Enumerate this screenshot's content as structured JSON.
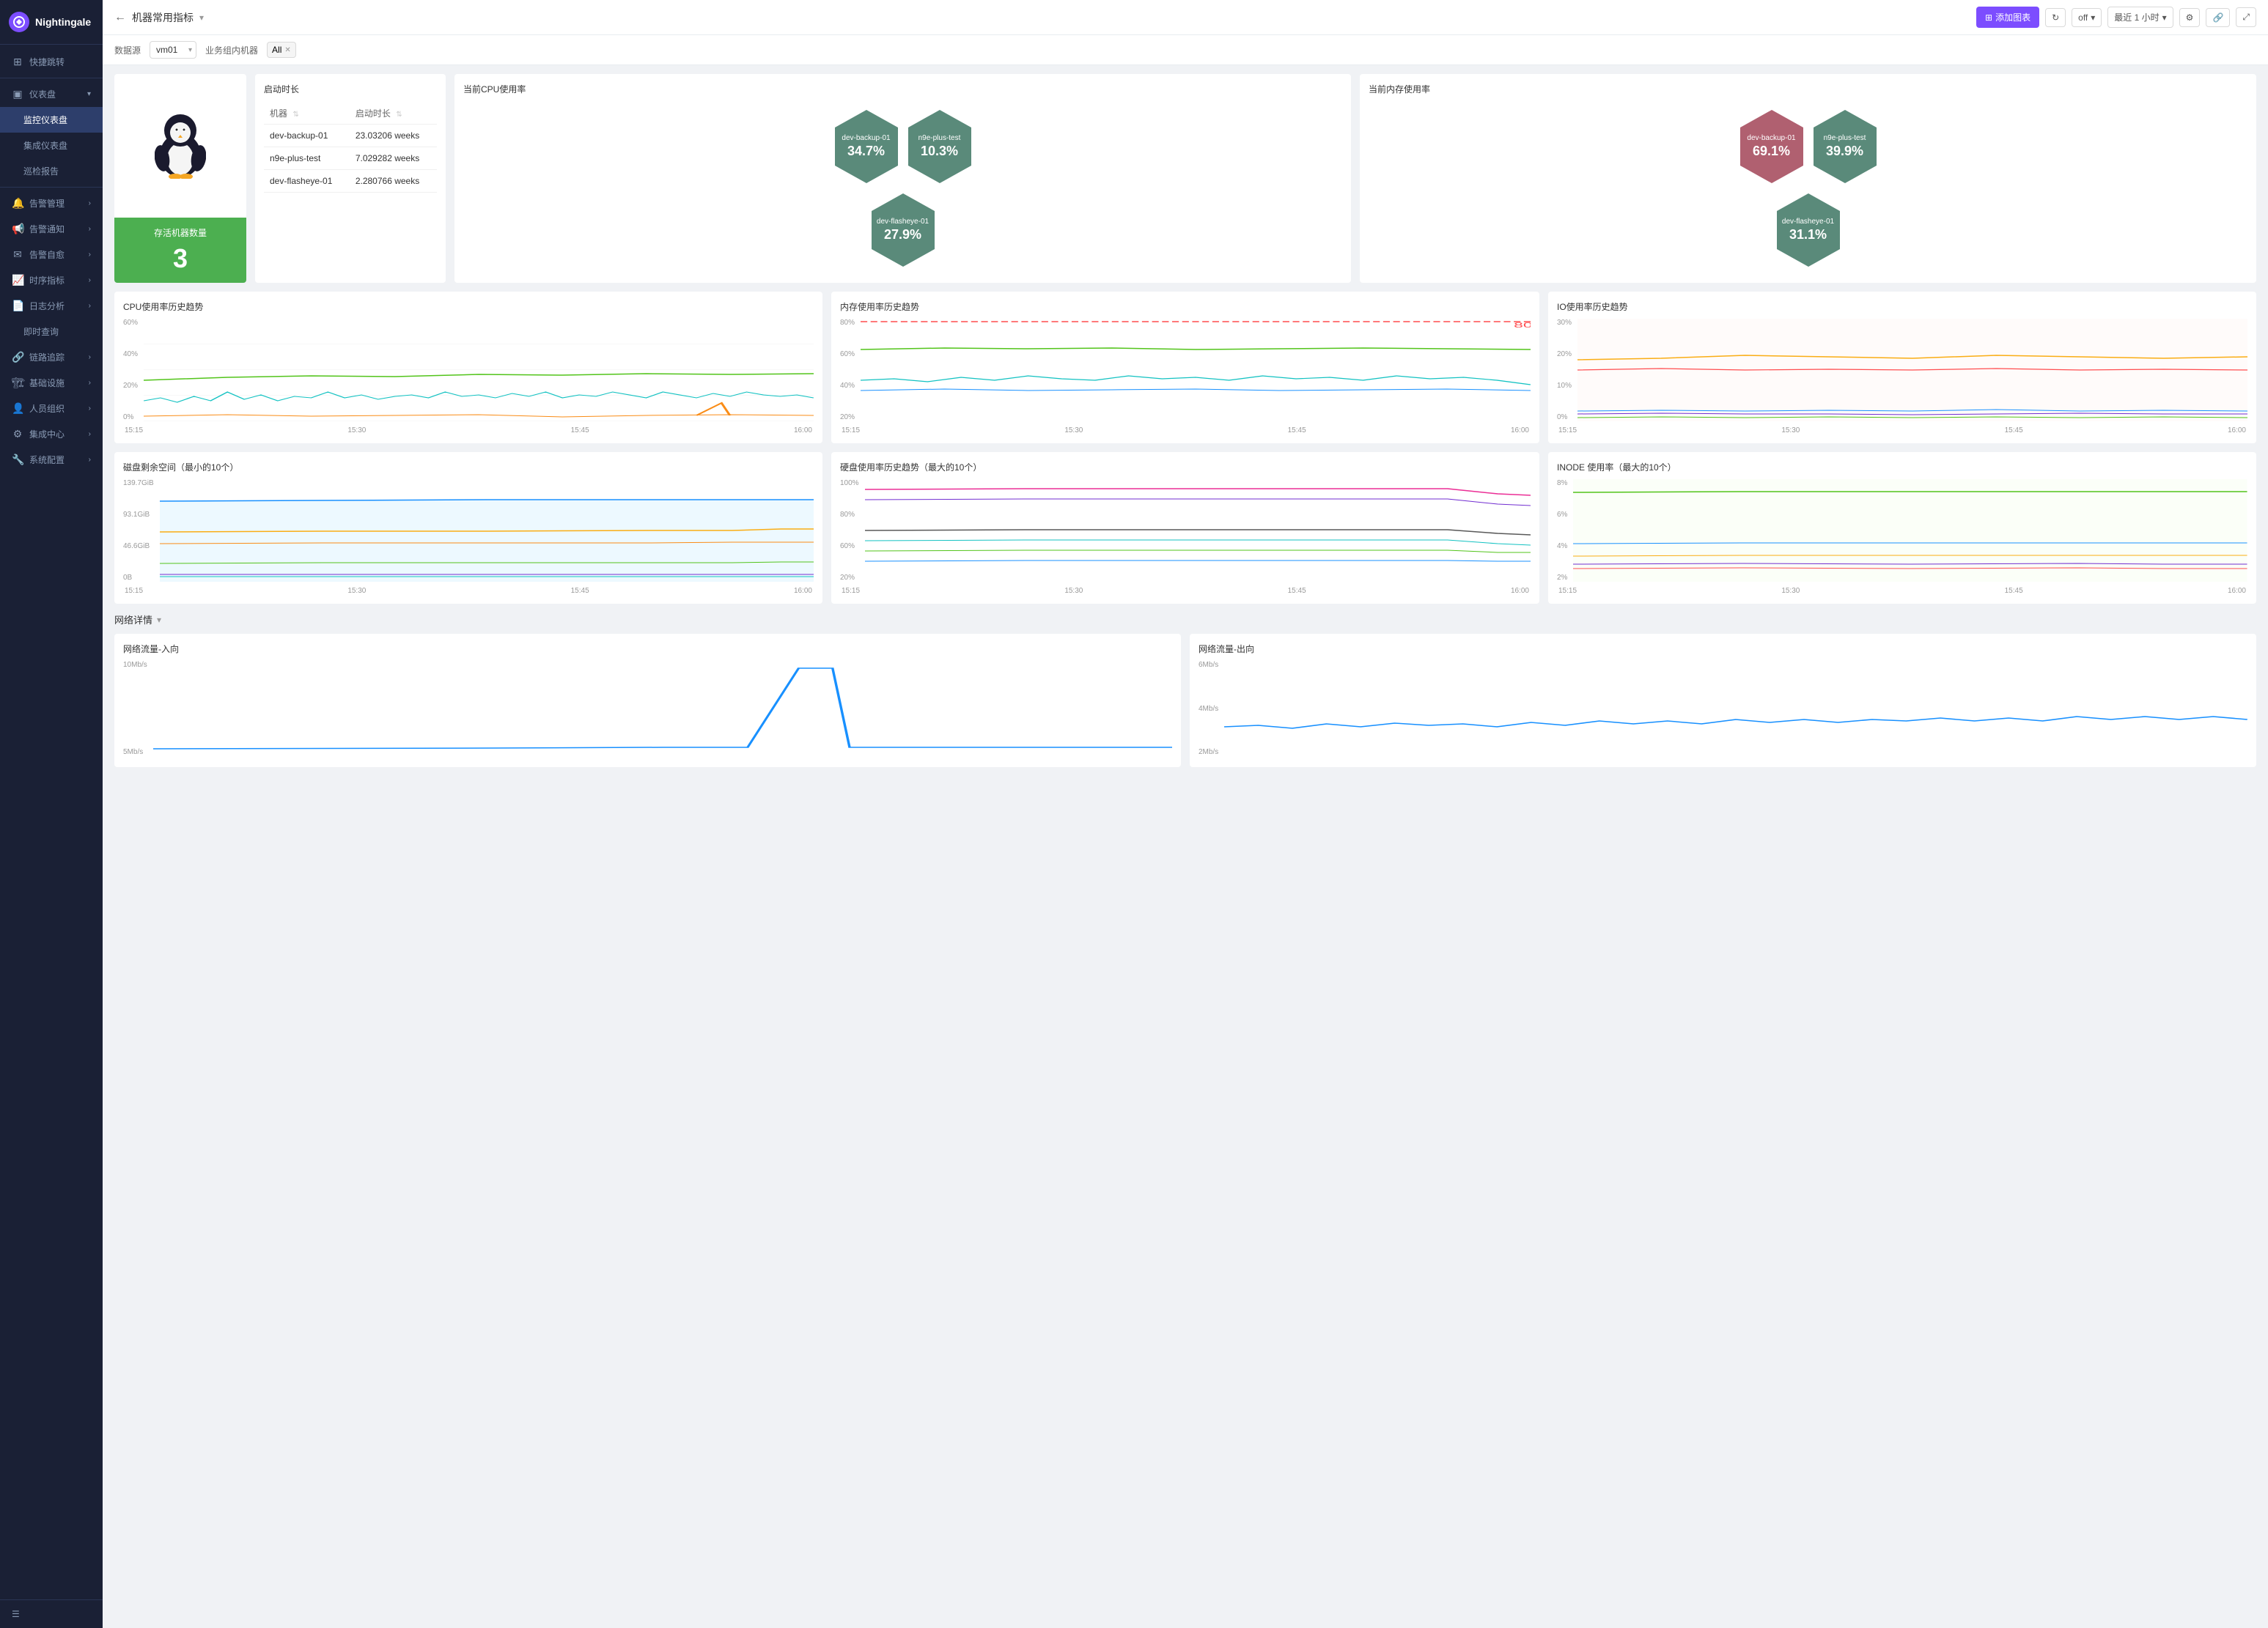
{
  "sidebar": {
    "logo_text": "Nightingale",
    "items": [
      {
        "id": "quick-jump",
        "label": "快捷跳转",
        "icon": "⊞",
        "has_arrow": false
      },
      {
        "id": "dashboard",
        "label": "仪表盘",
        "icon": "📊",
        "has_arrow": true
      },
      {
        "id": "monitor-dashboard",
        "label": "监控仪表盘",
        "icon": "",
        "has_arrow": false,
        "active": true,
        "sub": true
      },
      {
        "id": "integrated-dashboard",
        "label": "集成仪表盘",
        "icon": "",
        "has_arrow": false,
        "sub": true
      },
      {
        "id": "patrol-report",
        "label": "巡检报告",
        "icon": "",
        "has_arrow": false,
        "sub": true
      },
      {
        "id": "alert-management",
        "label": "告警管理",
        "icon": "🔔",
        "has_arrow": true
      },
      {
        "id": "alert-notify",
        "label": "告警通知",
        "icon": "📢",
        "has_arrow": true
      },
      {
        "id": "alert-self-heal",
        "label": "告警自愈",
        "icon": "✉",
        "has_arrow": true
      },
      {
        "id": "time-metrics",
        "label": "时序指标",
        "icon": "📈",
        "has_arrow": true
      },
      {
        "id": "log-analysis",
        "label": "日志分析",
        "icon": "📄",
        "has_arrow": true
      },
      {
        "id": "instant-query",
        "label": "即时查询",
        "icon": "",
        "has_arrow": false,
        "sub": true
      },
      {
        "id": "trace",
        "label": "链路追踪",
        "icon": "🔗",
        "has_arrow": true
      },
      {
        "id": "infrastructure",
        "label": "基础设施",
        "icon": "🏗",
        "has_arrow": true
      },
      {
        "id": "people-org",
        "label": "人员组织",
        "icon": "👤",
        "has_arrow": true
      },
      {
        "id": "integration",
        "label": "集成中心",
        "icon": "⚙",
        "has_arrow": true
      },
      {
        "id": "sys-config",
        "label": "系统配置",
        "icon": "🔧",
        "has_arrow": true
      }
    ],
    "bottom_icon": "☰"
  },
  "topbar": {
    "back_icon": "←",
    "title": "机器常用指标",
    "arrow": "▾",
    "add_chart_label": "添加图表",
    "refresh_icon": "↻",
    "auto_refresh_label": "off",
    "time_range_label": "最近 1 小时",
    "settings_icon": "⚙",
    "share_icon": "🔗",
    "fullscreen_icon": "⤢"
  },
  "filterbar": {
    "source_label": "数据源",
    "source_value": "vm01",
    "group_label": "业务组内机器",
    "group_tag": "All"
  },
  "top_panel": {
    "penguin_alt": "Linux Penguin",
    "live_machines_label": "存活机器数量",
    "live_machines_count": "3",
    "uptime_title": "启动时长",
    "uptime_col1": "机器",
    "uptime_col2": "启动时长",
    "uptime_rows": [
      {
        "machine": "dev-backup-01",
        "uptime": "23.03206 weeks"
      },
      {
        "machine": "n9e-plus-test",
        "uptime": "7.029282 weeks"
      },
      {
        "machine": "dev-flasheye-01",
        "uptime": "2.280766 weeks"
      }
    ],
    "cpu_title": "当前CPU使用率",
    "cpu_hexes": [
      {
        "name": "dev-backup-01",
        "value": "34.7%",
        "color": "#5a8a7a"
      },
      {
        "name": "n9e-plus-test",
        "value": "10.3%",
        "color": "#5a8a7a"
      },
      {
        "name": "dev-flasheye-01",
        "value": "27.9%",
        "color": "#5a8a7a"
      }
    ],
    "mem_title": "当前内存使用率",
    "mem_hexes": [
      {
        "name": "dev-backup-01",
        "value": "69.1%",
        "color": "#b06070"
      },
      {
        "name": "n9e-plus-test",
        "value": "39.9%",
        "color": "#5a8a7a"
      },
      {
        "name": "dev-flasheye-01",
        "value": "31.1%",
        "color": "#5a8a7a"
      }
    ]
  },
  "charts_row1": [
    {
      "title": "CPU使用率历史趋势",
      "y_max": "60%",
      "y_mid": "40%",
      "y_low": "20%",
      "y_min": "0%",
      "times": [
        "15:15",
        "15:30",
        "15:45",
        "16:00"
      ]
    },
    {
      "title": "内存使用率历史趋势",
      "y_max": "80%",
      "y_mid": "60%",
      "y_low": "40%",
      "y_min": "20%",
      "times": [
        "15:15",
        "15:30",
        "15:45",
        "16:00"
      ],
      "threshold": "80"
    },
    {
      "title": "IO使用率历史趋势",
      "y_max": "30%",
      "y_mid": "20%",
      "y_low": "10%",
      "y_min": "0%",
      "times": [
        "15:15",
        "15:30",
        "15:45",
        "16:00"
      ]
    }
  ],
  "charts_row2": [
    {
      "title": "磁盘剩余空间（最小的10个）",
      "y_max": "139.7GiB",
      "y_mid": "93.1GiB",
      "y_low": "46.6GiB",
      "y_min": "0B",
      "times": [
        "15:15",
        "15:30",
        "15:45",
        "16:00"
      ]
    },
    {
      "title": "硬盘使用率历史趋势（最大的10个）",
      "y_max": "100%",
      "y_mid": "80%",
      "y_low": "60%",
      "y_min": "20%",
      "times": [
        "15:15",
        "15:30",
        "15:45",
        "16:00"
      ]
    },
    {
      "title": "INODE 使用率（最大的10个）",
      "y_max": "8%",
      "y_mid": "6%",
      "y_low": "4%",
      "y_min": "2%",
      "times": [
        "15:15",
        "15:30",
        "15:45",
        "16:00"
      ]
    }
  ],
  "network_section": {
    "title": "网络详情",
    "arrow": "▾",
    "inbound_title": "网络流量-入向",
    "inbound_y_max": "10Mb/s",
    "inbound_y_mid": "5Mb/s",
    "outbound_title": "网络流量-出向",
    "outbound_y_max": "6Mb/s",
    "outbound_y_mid": "4Mb/s",
    "outbound_y_low": "2Mb/s"
  }
}
